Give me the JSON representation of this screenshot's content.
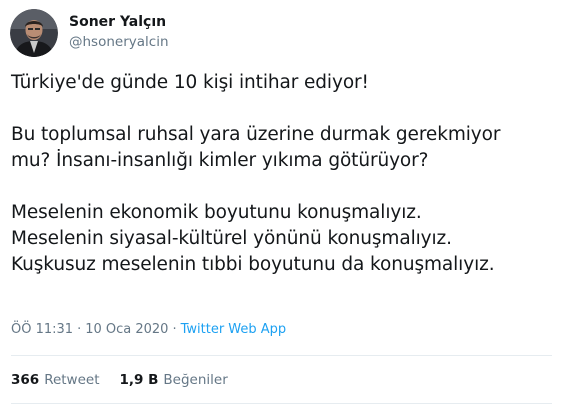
{
  "author": {
    "display_name": "Soner Yalçın",
    "handle": "@hsoneryalcin"
  },
  "tweet": {
    "paragraphs": [
      "Türkiye'de günde 10 kişi intihar ediyor!",
      "Bu toplumsal ruhsal yara üzerine durmak gerekmiyor\nmu? İnsanı-insanlığı kimler yıkıma götürüyor?",
      "Meselenin ekonomik boyutunu konuşmalıyız.\nMeselenin siyasal-kültürel yönünü konuşmalıyız.\nKuşkusuz meselenin tıbbi boyutunu da konuşmalıyız."
    ]
  },
  "meta": {
    "time": "ÖÖ 11:31",
    "separator": "·",
    "date": "10 Oca 2020",
    "source": "Twitter Web App"
  },
  "stats": {
    "retweets_count": "366",
    "retweets_label": "Retweet",
    "likes_count": "1,9 B",
    "likes_label": "Beğeniler"
  },
  "colors": {
    "text": "#14171a",
    "secondary": "#657786",
    "link": "#1da1f2",
    "divider": "#e6ecf0"
  }
}
